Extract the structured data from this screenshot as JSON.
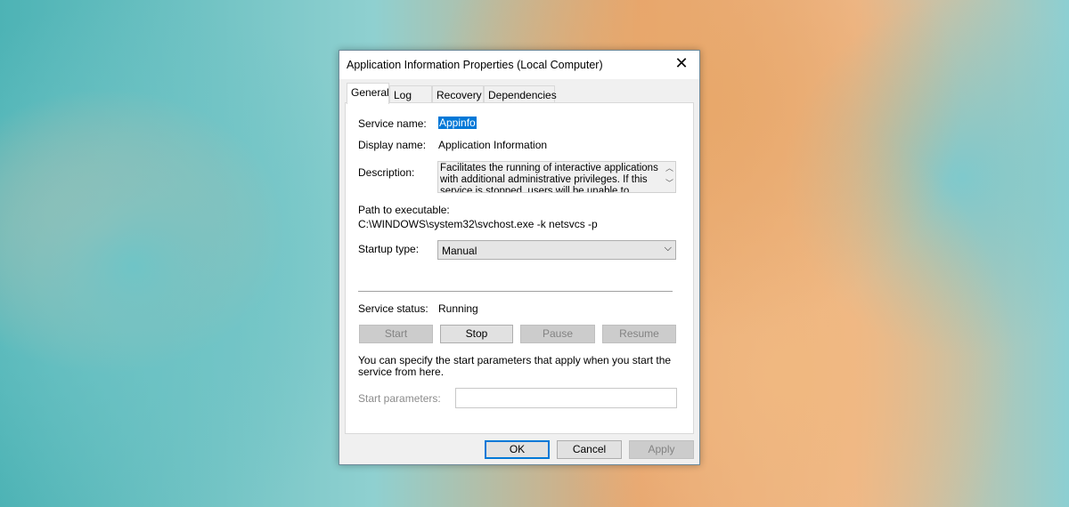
{
  "dialog": {
    "title": "Application Information Properties (Local Computer)",
    "close_icon": "close-icon"
  },
  "tabs": [
    {
      "label": "General",
      "active": true
    },
    {
      "label": "Log On"
    },
    {
      "label": "Recovery"
    },
    {
      "label": "Dependencies"
    }
  ],
  "general": {
    "service_name_label": "Service name:",
    "service_name": "Appinfo",
    "display_name_label": "Display name:",
    "display_name": "Application Information",
    "description_label": "Description:",
    "description": "Facilitates the running of interactive applications with additional administrative privileges.  If this service is stopped, users will be unable to launch applications",
    "path_label": "Path to executable:",
    "path": "C:\\WINDOWS\\system32\\svchost.exe -k netsvcs -p",
    "startup_type_label": "Startup type:",
    "startup_type": "Manual",
    "service_status_label": "Service status:",
    "service_status": "Running",
    "buttons": {
      "start": "Start",
      "stop": "Stop",
      "pause": "Pause",
      "resume": "Resume"
    },
    "params_hint": "You can specify the start parameters that apply when you start the service from here.",
    "start_params_label": "Start parameters:",
    "start_params_value": ""
  },
  "footer": {
    "ok": "OK",
    "cancel": "Cancel",
    "apply": "Apply"
  }
}
